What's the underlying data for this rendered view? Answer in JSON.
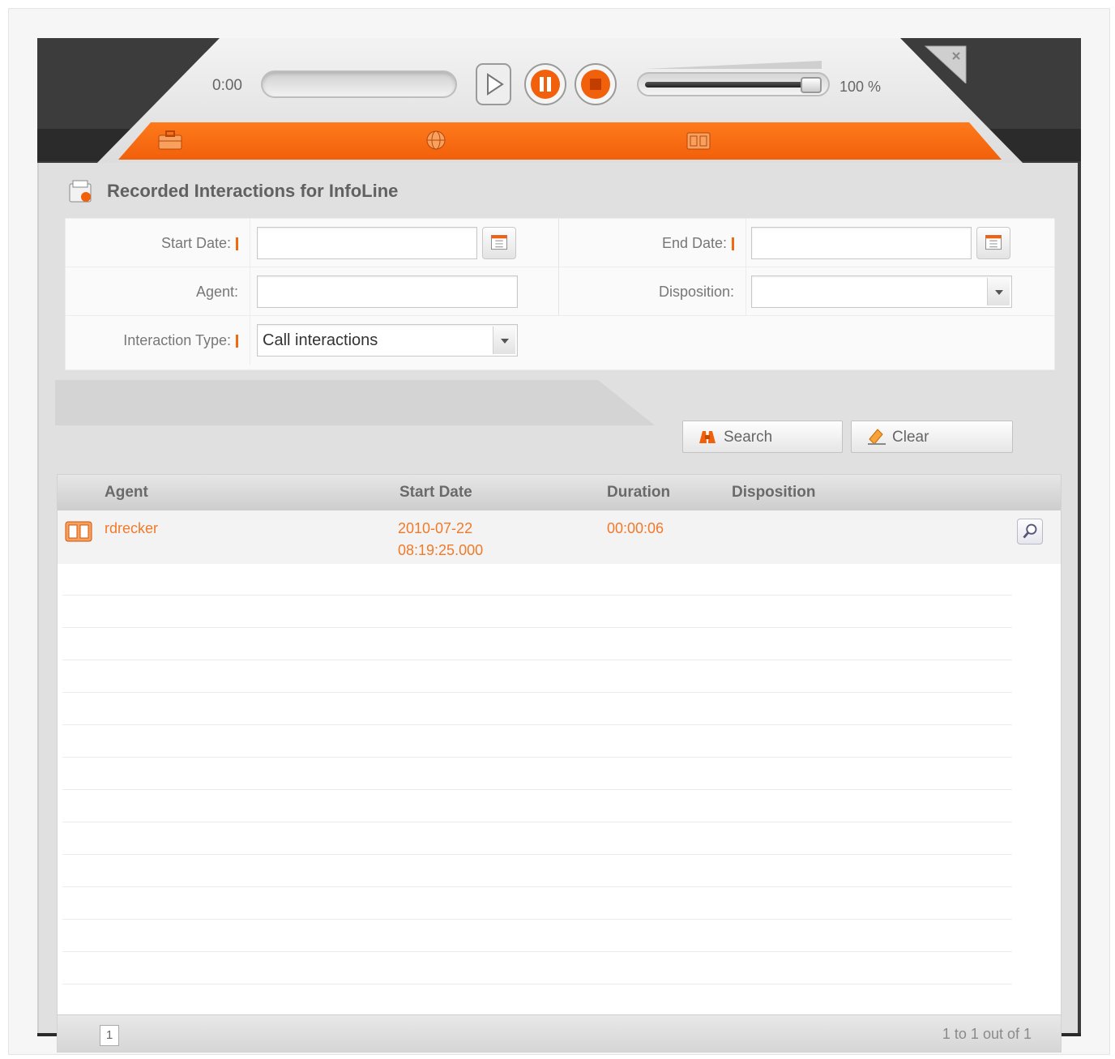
{
  "player": {
    "time": "0:00",
    "progress": 0.0,
    "volume_percent": 100,
    "volume_label": "100 %",
    "buttons": [
      "play",
      "pause",
      "stop"
    ]
  },
  "tabs": [
    {
      "icon": "briefcase-icon"
    },
    {
      "icon": "globe-icon"
    },
    {
      "icon": "recorder-icon"
    }
  ],
  "panel": {
    "title": "Recorded Interactions for InfoLine"
  },
  "form": {
    "start_date_label": "Start Date:",
    "start_date_value": "",
    "end_date_label": "End Date:",
    "end_date_value": "",
    "agent_label": "Agent:",
    "agent_value": "",
    "disposition_label": "Disposition:",
    "disposition_value": "",
    "interaction_type_label": "Interaction Type:",
    "interaction_type_value": "Call interactions"
  },
  "actions": {
    "search_label": "Search",
    "clear_label": "Clear"
  },
  "grid": {
    "columns": [
      "Agent",
      "Start Date",
      "Duration",
      "Disposition"
    ],
    "rows": [
      {
        "agent": "rdrecker",
        "start_date_line1": "2010-07-22",
        "start_date_line2": "08:19:25.000",
        "duration": "00:00:06",
        "disposition": ""
      }
    ],
    "page": "1",
    "pager_text": "1 to 1 out of 1"
  },
  "colors": {
    "accent": "#f1600a",
    "row_text": "#f07a2a"
  }
}
